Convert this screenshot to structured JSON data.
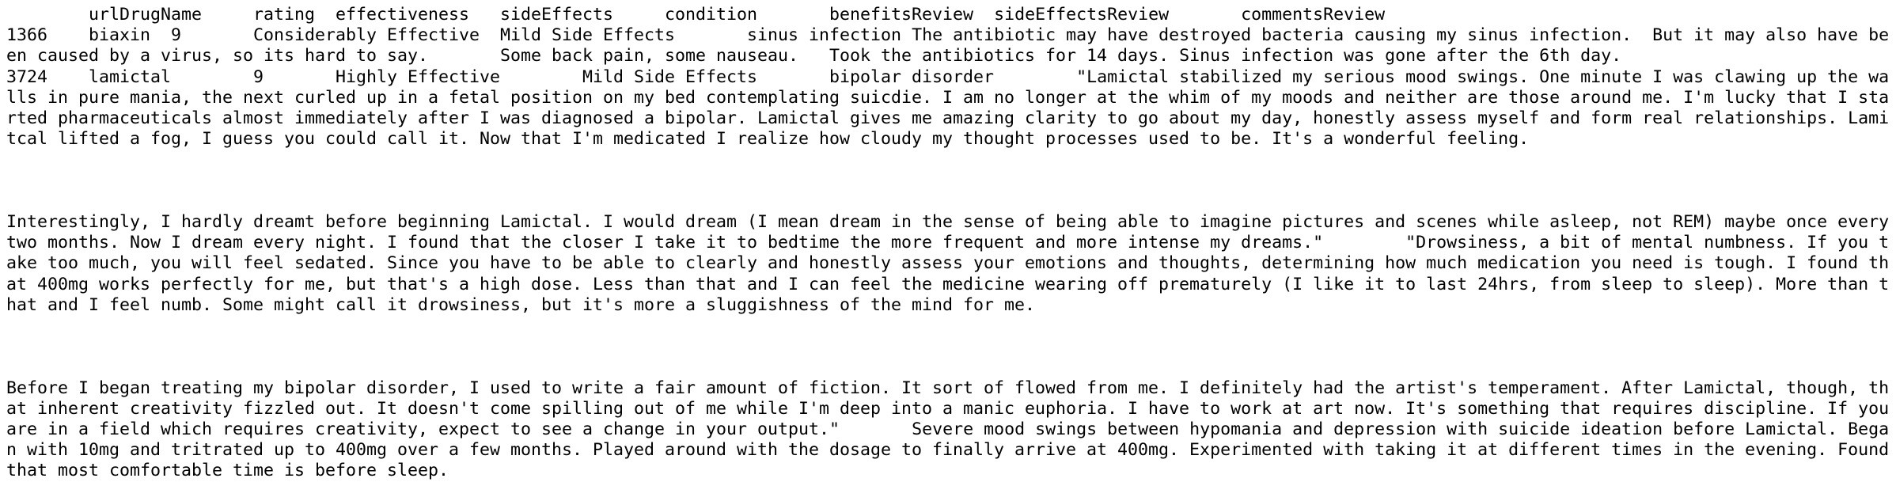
{
  "document": {
    "lines": [
      "\turlDrugName\trating\teffectiveness\tsideEffects\tcondition\tbenefitsReview\tsideEffectsReview\tcommentsReview",
      "1366\tbiaxin\t9\tConsiderably Effective\tMild Side Effects\tsinus infection\tThe antibiotic may have destroyed bacteria causing my sinus infection.  But it may also have been caused by a virus, so its hard to say.\tSome back pain, some nauseau.\tTook the antibiotics for 14 days. Sinus infection was gone after the 6th day.",
      "3724\tlamictal\t9\tHighly Effective\tMild Side Effects\tbipolar disorder\t\"Lamictal stabilized my serious mood swings. One minute I was clawing up the walls in pure mania, the next curled up in a fetal position on my bed contemplating suicdie. I am no longer at the whim of my moods and neither are those around me. I'm lucky that I started pharmaceuticals almost immediately after I was diagnosed a bipolar. Lamictal gives me amazing clarity to go about my day, honestly assess myself and form real relationships. Lamitcal lifted a fog, I guess you could call it. Now that I'm medicated I realize how cloudy my thought processes used to be. It's a wonderful feeling.",
      "",
      "",
      "",
      "Interestingly, I hardly dreamt before beginning Lamictal. I would dream (I mean dream in the sense of being able to imagine pictures and scenes while asleep, not REM) maybe once every two months. Now I dream every night. I found that the closer I take it to bedtime the more frequent and more intense my dreams.\"\t\"Drowsiness, a bit of mental numbness. If you take too much, you will feel sedated. Since you have to be able to clearly and honestly assess your emotions and thoughts, determining how much medication you need is tough. I found that 400mg works perfectly for me, but that's a high dose. Less than that and I can feel the medicine wearing off prematurely (I like it to last 24hrs, from sleep to sleep). More than that and I feel numb. Some might call it drowsiness, but it's more a sluggishness of the mind for me.",
      "",
      "",
      "",
      "Before I began treating my bipolar disorder, I used to write a fair amount of fiction. It sort of flowed from me. I definitely had the artist's temperament. After Lamictal, though, that inherent creativity fizzled out. It doesn't come spilling out of me while I'm deep into a manic euphoria. I have to work at art now. It's something that requires discipline. If you are in a field which requires creativity, expect to see a change in your output.\"\tSevere mood swings between hypomania and depression with suicide ideation before Lamictal. Began with 10mg and tritrated up to 400mg over a few months. Played around with the dosage to finally arrive at 400mg. Experimented with taking it at different times in the evening. Found that most comfortable time is before sleep."
    ]
  }
}
